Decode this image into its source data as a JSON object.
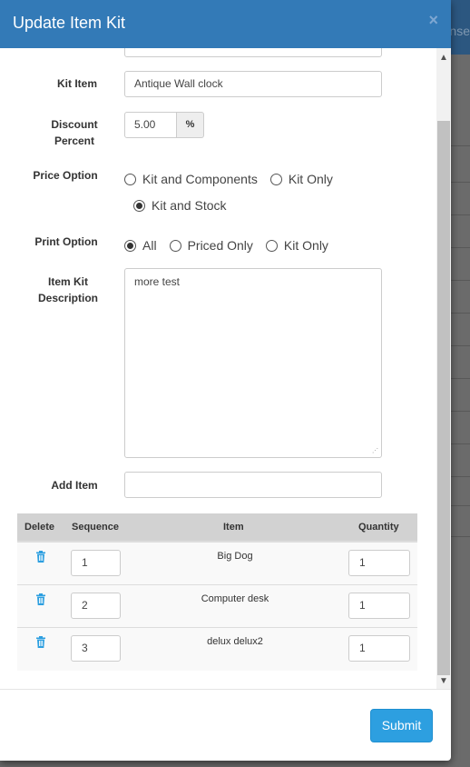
{
  "background": {
    "header_text": "nse"
  },
  "modal": {
    "title": "Update Item Kit",
    "close_icon": "×"
  },
  "form": {
    "kit_item": {
      "label": "Kit Item",
      "value": "Antique Wall clock"
    },
    "discount": {
      "label_line1": "Discount",
      "label_line2": "Percent",
      "value": "5.00",
      "addon": "%"
    },
    "price_option": {
      "label": "Price Option",
      "options": [
        "Kit and Components",
        "Kit Only",
        "Kit and Stock"
      ],
      "selected": "Kit and Stock"
    },
    "print_option": {
      "label": "Print Option",
      "options": [
        "All",
        "Priced Only",
        "Kit Only"
      ],
      "selected": "All"
    },
    "description": {
      "label_line1": "Item Kit",
      "label_line2": "Description",
      "value": "more test"
    },
    "add_item": {
      "label": "Add Item",
      "value": ""
    }
  },
  "table": {
    "headers": [
      "Delete",
      "Sequence",
      "Item",
      "Quantity"
    ],
    "rows": [
      {
        "sequence": "1",
        "item": "Big Dog",
        "quantity": "1"
      },
      {
        "sequence": "2",
        "item": "Computer desk",
        "quantity": "1"
      },
      {
        "sequence": "3",
        "item": "delux delux2",
        "quantity": "1"
      }
    ]
  },
  "footer": {
    "submit_label": "Submit"
  },
  "colors": {
    "header": "#337ab7",
    "submit": "#2d9fe0",
    "trash_icon": "#2d9fe0"
  },
  "icons": {
    "delete": "trash-icon",
    "close": "close-icon",
    "scroll_up": "chevron-up-icon",
    "scroll_down": "chevron-down-icon"
  }
}
